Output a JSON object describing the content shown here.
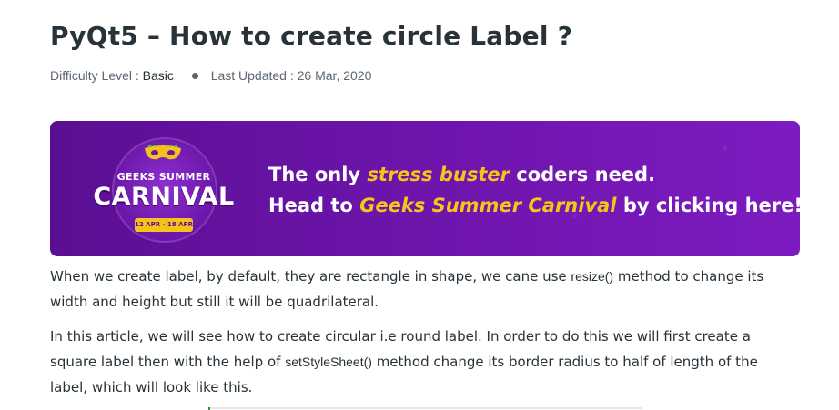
{
  "article": {
    "title": "PyQt5 – How to create circle Label ?",
    "meta": {
      "difficulty_label": "Difficulty Level : ",
      "difficulty_value": "Basic",
      "updated_label": "Last Updated : ",
      "updated_value": "26 Mar, 2020"
    },
    "banner": {
      "logo_top": "GEEKS SUMMER",
      "logo_main": "CARNIVAL",
      "logo_dates": "12 APR - 18 APR",
      "line1_pre": "The only ",
      "line1_highlight": "stress buster",
      "line1_post": " coders need.",
      "line2_pre": "Head to ",
      "line2_highlight": "Geeks Summer Carnival",
      "line2_post": " by clicking here!",
      "colors": {
        "background": "#6c14aa",
        "highlight": "#f5c518",
        "text": "#ffffff"
      }
    },
    "paragraphs": [
      {
        "pre": "When we create label, by default, they are rectangle in shape, we cane use ",
        "code": "resize()",
        "post": " method to change its width and height but still it will be quadrilateral."
      },
      {
        "pre": "In this article, we will see how to create circular i.e round label. In order to do this we will first create a square label then with the help of ",
        "code": "setStyleSheet()",
        "post": " method change its border radius to half of length of the label, which will look like this."
      }
    ]
  }
}
